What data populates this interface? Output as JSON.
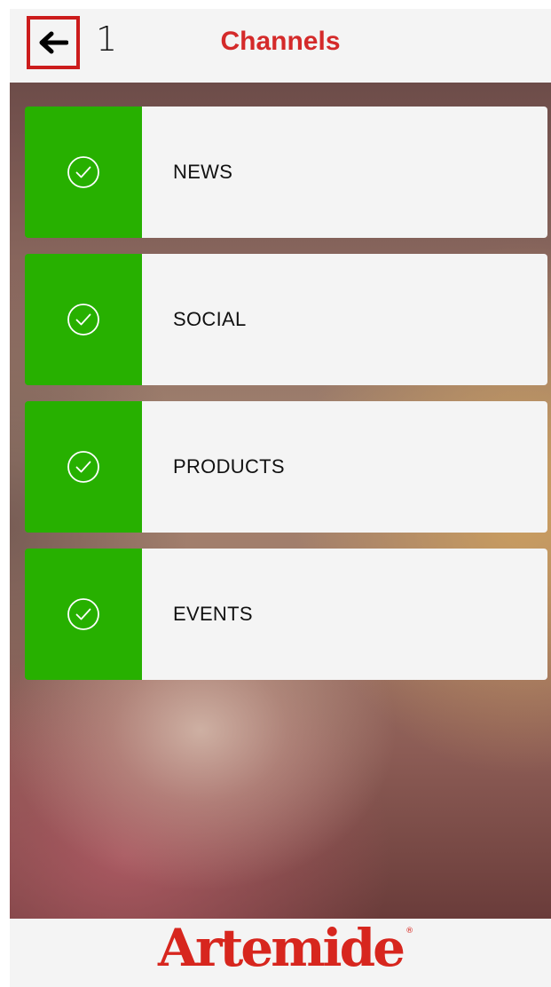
{
  "header": {
    "back_icon": "arrow-left-icon",
    "step": "1",
    "title": "Channels",
    "title_color": "#d42a2a"
  },
  "channels": [
    {
      "label": "NEWS",
      "selected": true,
      "icon": "check-circle-icon"
    },
    {
      "label": "SOCIAL",
      "selected": true,
      "icon": "check-circle-icon"
    },
    {
      "label": "PRODUCTS",
      "selected": true,
      "icon": "check-circle-icon"
    },
    {
      "label": "EVENTS",
      "selected": true,
      "icon": "check-circle-icon"
    }
  ],
  "colors": {
    "selected_green": "#27b000",
    "brand_red": "#d7261e",
    "back_highlight": "#cc1c1c"
  },
  "footer": {
    "logo_text": "Artemide",
    "logo_mark": "®"
  }
}
